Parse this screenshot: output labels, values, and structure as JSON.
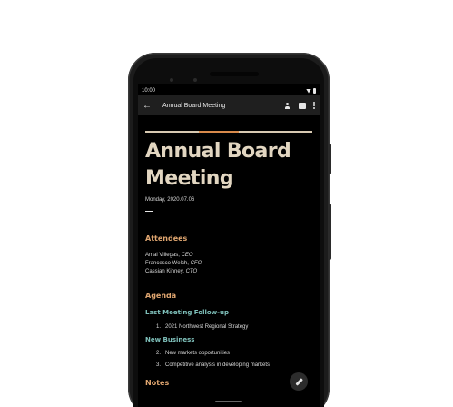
{
  "status_bar": {
    "time": "10:00",
    "icons": [
      "wifi-icon",
      "battery-icon"
    ]
  },
  "app_bar": {
    "back_icon": "arrow-back-icon",
    "title": "Annual Board Meeting",
    "actions": [
      "person-add-icon",
      "comment-icon",
      "more-vert-icon"
    ]
  },
  "document": {
    "title_line1": "Annual Board",
    "title_line2": "Meeting",
    "date": "Monday, 2020.07.06",
    "attendees": {
      "heading": "Attendees",
      "people": [
        {
          "name": "Amal Villegas,",
          "role": "CEO"
        },
        {
          "name": "Francesco Welch,",
          "role": "CFO"
        },
        {
          "name": "Cassian Kinney,",
          "role": "CTO"
        }
      ]
    },
    "agenda": {
      "heading": "Agenda",
      "sections": [
        {
          "heading": "Last Meeting Follow-up",
          "items": [
            {
              "num": "1.",
              "text": "2021 Northwest Regional Strategy"
            }
          ]
        },
        {
          "heading": "New Business",
          "items": [
            {
              "num": "2.",
              "text": "New markets opportunities"
            },
            {
              "num": "3.",
              "text": "Competitive analysis in developing markets"
            }
          ]
        }
      ]
    },
    "notes_heading": "Notes"
  },
  "fab": {
    "icon": "edit-pencil-icon"
  },
  "colors": {
    "title": "#e2d6c1",
    "section_heading": "#e0a670",
    "subheading": "#7fc1bb",
    "accent_orange": "#d88a4b",
    "appbar_bg": "#1f1f1f"
  }
}
